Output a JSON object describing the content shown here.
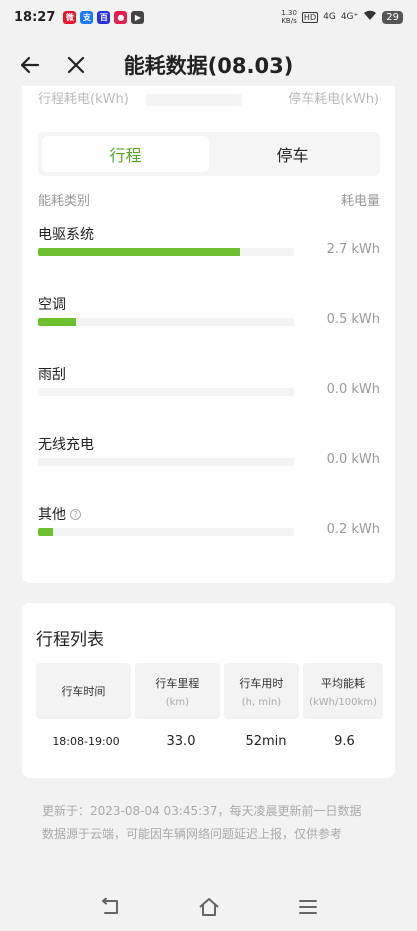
{
  "status_bar": {
    "time": "18:27",
    "net_speed": "1.30\nKB/s",
    "hd": "HD",
    "signal1": "4G",
    "signal2": "4G⁺",
    "battery": "29",
    "app_icons": [
      "weibo-icon",
      "alipay-icon",
      "baidu-icon",
      "app-red-icon",
      "media-icon"
    ]
  },
  "nav": {
    "title": "能耗数据(08.03)"
  },
  "summary_clipped": {
    "left_label": "行程耗电(kWh)",
    "right_label": "停车耗电(kWh)"
  },
  "segment": {
    "active": "行程",
    "inactive": "停车"
  },
  "energy": {
    "header_left": "能耗类别",
    "header_right": "耗电量",
    "categories": [
      {
        "name": "电驱系统",
        "value": "2.7 kWh",
        "fraction": 0.79
      },
      {
        "name": "空调",
        "value": "0.5 kWh",
        "fraction": 0.15
      },
      {
        "name": "雨刮",
        "value": "0.0 kWh",
        "fraction": 0.0
      },
      {
        "name": "无线充电",
        "value": "0.0 kWh",
        "fraction": 0.0
      },
      {
        "name": "其他",
        "value": "0.2 kWh",
        "fraction": 0.06
      }
    ]
  },
  "trips": {
    "title": "行程列表",
    "columns": [
      {
        "label": "行车时间",
        "unit": ""
      },
      {
        "label": "行车里程",
        "unit": "(km)"
      },
      {
        "label": "行车用时",
        "unit": "(h, min)"
      },
      {
        "label": "平均能耗",
        "unit": "(kWh/100km)"
      }
    ],
    "rows": [
      {
        "time": "18:08-19:00",
        "distance": "33.0",
        "duration": "52min",
        "avg": "9.6"
      }
    ]
  },
  "footer": {
    "line1": "更新于：2023-08-04 03:45:37，每天凌晨更新前一日数据",
    "line2": "数据源于云端，可能因车辆网络问题延迟上报，仅供参考"
  },
  "colors": {
    "accent_green": "#6cbf2e",
    "active_text": "#5aa528"
  }
}
